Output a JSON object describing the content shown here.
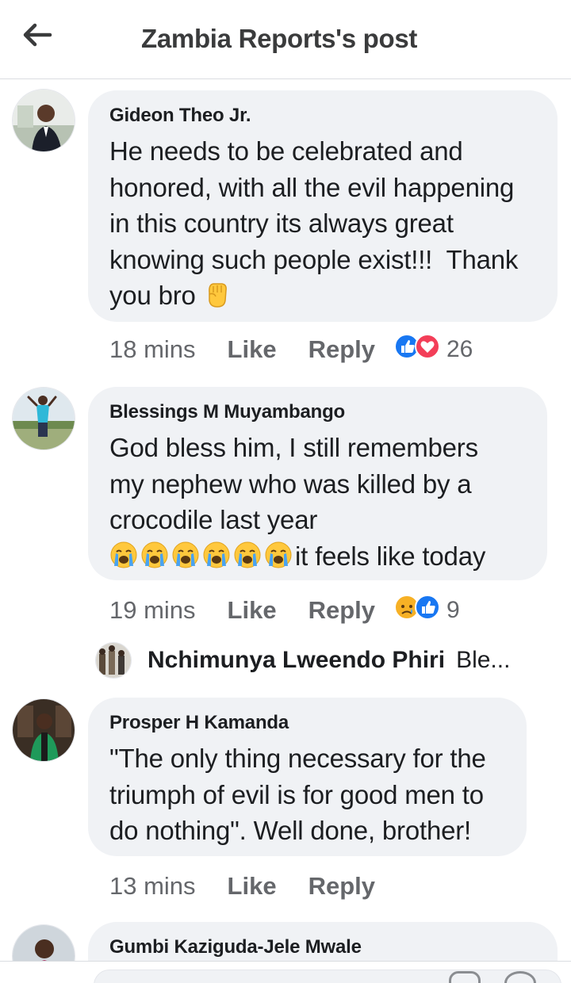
{
  "header": {
    "title": "Zambia Reports's post",
    "back_icon": "arrow-left-icon"
  },
  "comments": [
    {
      "author": "Gideon Theo Jr.",
      "text": "He needs to be celebrated and\nhonored, with all the evil happening\nin this country its always great\nknowing such people exist!!!  Thank\nyou bro ",
      "emoji": "raised-fist-icon",
      "time": "18 mins",
      "like": "Like",
      "reply": "Reply",
      "reactions": [
        "like",
        "love"
      ],
      "reaction_count": "26"
    },
    {
      "author": "Blessings M Muyambango",
      "text": "God bless him, I still remembers\nmy nephew who was killed by a\ncrocodile last year\n",
      "trailing_text": "it feels like today",
      "emoji": "loudly-crying-face-icon",
      "emoji_count": 6,
      "time": "19 mins",
      "like": "Like",
      "reply": "Reply",
      "reactions": [
        "sad",
        "like"
      ],
      "reaction_count": "9"
    },
    {
      "author": "Prosper H Kamanda",
      "text": "\"The only thing necessary for the\ntriumph of evil is for good men to\ndo nothing\". Well done, brother!",
      "time": "13 mins",
      "like": "Like",
      "reply": "Reply"
    },
    {
      "author": "Gumbi Kaziguda-Jele Mwale"
    }
  ],
  "reply_preview": {
    "author": "Nchimunya Lweendo Phiri",
    "text": "Ble..."
  },
  "colors": {
    "bubble": "#f0f2f5",
    "like_blue": "#1877f2",
    "love_red": "#f33e58",
    "meta_gray": "#65676b"
  }
}
